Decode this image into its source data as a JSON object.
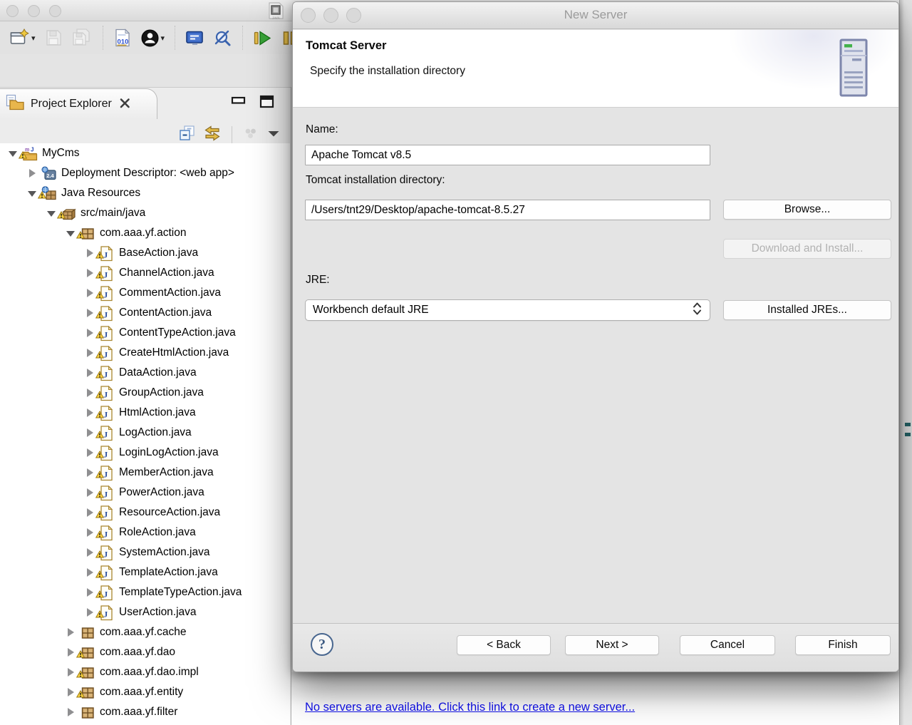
{
  "toolbar": {
    "items": [
      {
        "name": "new-wizard",
        "dropdown": true
      },
      {
        "name": "save",
        "disabled": true
      },
      {
        "name": "save-all",
        "disabled": true
      },
      {
        "separator": true
      },
      {
        "name": "binary-file"
      },
      {
        "name": "user",
        "dropdown": true
      },
      {
        "separator": true
      },
      {
        "name": "remote-console"
      },
      {
        "name": "no-search"
      },
      {
        "separator": true
      },
      {
        "name": "run"
      },
      {
        "name": "pause"
      }
    ]
  },
  "explorer": {
    "tab_label": "Project Explorer",
    "view_toolbar": [
      "collapse-all",
      "link-editor",
      "menu-dots",
      "view-dropdown"
    ],
    "tree": [
      {
        "label": "MyCms",
        "level": 0,
        "state": "expanded",
        "icon": "web-project",
        "warning": true
      },
      {
        "label": "Deployment Descriptor: <web app>",
        "level": 1,
        "state": "collapsed",
        "icon": "deployment-descriptor",
        "warning": false
      },
      {
        "label": "Java Resources",
        "level": 1,
        "state": "expanded",
        "icon": "java-resources",
        "warning": true
      },
      {
        "label": "src/main/java",
        "level": 2,
        "state": "expanded",
        "icon": "src-folder",
        "warning": true
      },
      {
        "label": "com.aaa.yf.action",
        "level": 3,
        "state": "expanded",
        "icon": "package",
        "warning": true
      },
      {
        "label": "BaseAction.java",
        "level": 4,
        "state": "collapsed",
        "icon": "java-file",
        "warning": true
      },
      {
        "label": "ChannelAction.java",
        "level": 4,
        "state": "collapsed",
        "icon": "java-file",
        "warning": true
      },
      {
        "label": "CommentAction.java",
        "level": 4,
        "state": "collapsed",
        "icon": "java-file",
        "warning": true
      },
      {
        "label": "ContentAction.java",
        "level": 4,
        "state": "collapsed",
        "icon": "java-file",
        "warning": true
      },
      {
        "label": "ContentTypeAction.java",
        "level": 4,
        "state": "collapsed",
        "icon": "java-file",
        "warning": true
      },
      {
        "label": "CreateHtmlAction.java",
        "level": 4,
        "state": "collapsed",
        "icon": "java-file",
        "warning": true
      },
      {
        "label": "DataAction.java",
        "level": 4,
        "state": "collapsed",
        "icon": "java-file",
        "warning": true
      },
      {
        "label": "GroupAction.java",
        "level": 4,
        "state": "collapsed",
        "icon": "java-file",
        "warning": true
      },
      {
        "label": "HtmlAction.java",
        "level": 4,
        "state": "collapsed",
        "icon": "java-file",
        "warning": true
      },
      {
        "label": "LogAction.java",
        "level": 4,
        "state": "collapsed",
        "icon": "java-file",
        "warning": true
      },
      {
        "label": "LoginLogAction.java",
        "level": 4,
        "state": "collapsed",
        "icon": "java-file",
        "warning": true
      },
      {
        "label": "MemberAction.java",
        "level": 4,
        "state": "collapsed",
        "icon": "java-file",
        "warning": true
      },
      {
        "label": "PowerAction.java",
        "level": 4,
        "state": "collapsed",
        "icon": "java-file",
        "warning": true
      },
      {
        "label": "ResourceAction.java",
        "level": 4,
        "state": "collapsed",
        "icon": "java-file",
        "warning": true
      },
      {
        "label": "RoleAction.java",
        "level": 4,
        "state": "collapsed",
        "icon": "java-file",
        "warning": true
      },
      {
        "label": "SystemAction.java",
        "level": 4,
        "state": "collapsed",
        "icon": "java-file",
        "warning": true
      },
      {
        "label": "TemplateAction.java",
        "level": 4,
        "state": "collapsed",
        "icon": "java-file",
        "warning": true
      },
      {
        "label": "TemplateTypeAction.java",
        "level": 4,
        "state": "collapsed",
        "icon": "java-file",
        "warning": true
      },
      {
        "label": "UserAction.java",
        "level": 4,
        "state": "collapsed",
        "icon": "java-file",
        "warning": true
      },
      {
        "label": "com.aaa.yf.cache",
        "level": 3,
        "state": "collapsed",
        "icon": "package",
        "warning": false
      },
      {
        "label": "com.aaa.yf.dao",
        "level": 3,
        "state": "collapsed",
        "icon": "package",
        "warning": true
      },
      {
        "label": "com.aaa.yf.dao.impl",
        "level": 3,
        "state": "collapsed",
        "icon": "package",
        "warning": true
      },
      {
        "label": "com.aaa.yf.entity",
        "level": 3,
        "state": "collapsed",
        "icon": "package",
        "warning": true
      },
      {
        "label": "com.aaa.yf.filter",
        "level": 3,
        "state": "collapsed",
        "icon": "package",
        "warning": false
      }
    ]
  },
  "dialog": {
    "window_title": "New Server",
    "banner": {
      "title": "Tomcat Server",
      "subtitle": "Specify the installation directory"
    },
    "form": {
      "name_label": "Name:",
      "name_value": "Apache Tomcat v8.5",
      "directory_label": "Tomcat installation directory:",
      "directory_value": "/Users/tnt29/Desktop/apache-tomcat-8.5.27",
      "jre_label": "JRE:",
      "jre_value": "Workbench default JRE"
    },
    "buttons": {
      "browse": "Browse...",
      "download_install": "Download and Install...",
      "installed_jres": "Installed JREs...",
      "help": "?",
      "back": "< Back",
      "next": "Next >",
      "cancel": "Cancel",
      "finish": "Finish"
    }
  },
  "servers_view": {
    "empty_link": "No servers are available. Click this link to create a new server..."
  },
  "colors": {
    "link": "#1010ee",
    "warning_yellow": "#fbd340",
    "run_green": "#39a339",
    "accent_blue": "#3b69c6",
    "gold": "#e3bc49"
  }
}
